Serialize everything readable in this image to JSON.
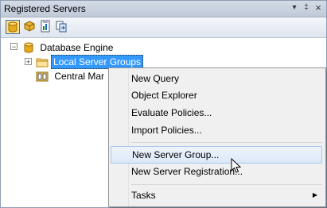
{
  "window": {
    "title": "Registered Servers",
    "dropdown_glyph": "▾",
    "pin_glyph": "‡",
    "close_glyph": "×"
  },
  "toolbar": {
    "icons": [
      "database-engine-icon",
      "analysis-services-icon",
      "reporting-services-icon",
      "integration-services-icon"
    ]
  },
  "tree": {
    "root_label": "Database Engine",
    "root_expander": "−",
    "child_expander": "+",
    "local_groups_label": "Local Server Groups",
    "central_label": "Central Mar"
  },
  "context_menu": {
    "items": [
      "New Query",
      "Object Explorer",
      "Evaluate Policies...",
      "Import Policies...",
      "New Server Group...",
      "New Server Registration...",
      "Tasks"
    ],
    "submenu_arrow": "▶"
  }
}
